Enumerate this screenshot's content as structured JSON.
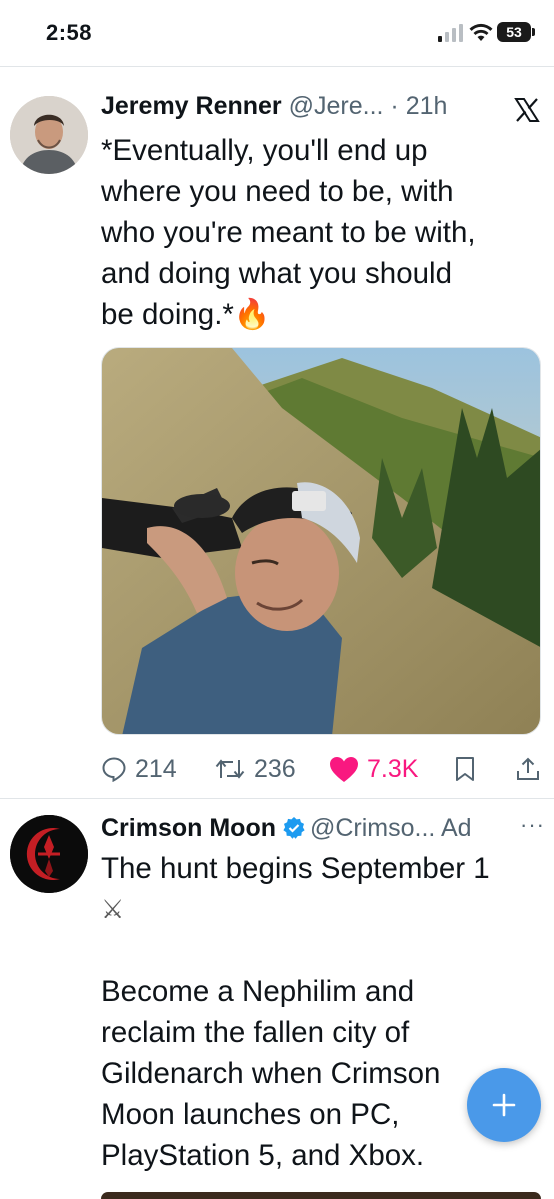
{
  "status_bar": {
    "time": "2:58",
    "battery": "53"
  },
  "tweet": {
    "name": "Jeremy Renner",
    "handle": "@Jere...",
    "dot": " · ",
    "time": "21h",
    "text_lines": [
      "*Eventually, you'll end up",
      "where you need to be, with",
      "who you're meant to be with,",
      "and doing what you should",
      "be doing.*"
    ],
    "emoji": "🔥",
    "replies": "214",
    "retweets": "236",
    "likes": "7.3K"
  },
  "ad": {
    "name": "Crimson Moon",
    "handle": "@Crimso...",
    "ad_label": "Ad",
    "more": "···",
    "line1": "The hunt begins September 1",
    "swords": "⚔",
    "body_lines": [
      "Become a Nephilim and",
      "reclaim the fallen city of",
      "Gildenarch when Crimson",
      "Moon launches on PC,",
      "PlayStation 5, and Xbox."
    ]
  },
  "colors": {
    "like": "#f91880",
    "muted": "#536471",
    "fab": "#4a99e9",
    "verified": "#1d9bf0"
  }
}
